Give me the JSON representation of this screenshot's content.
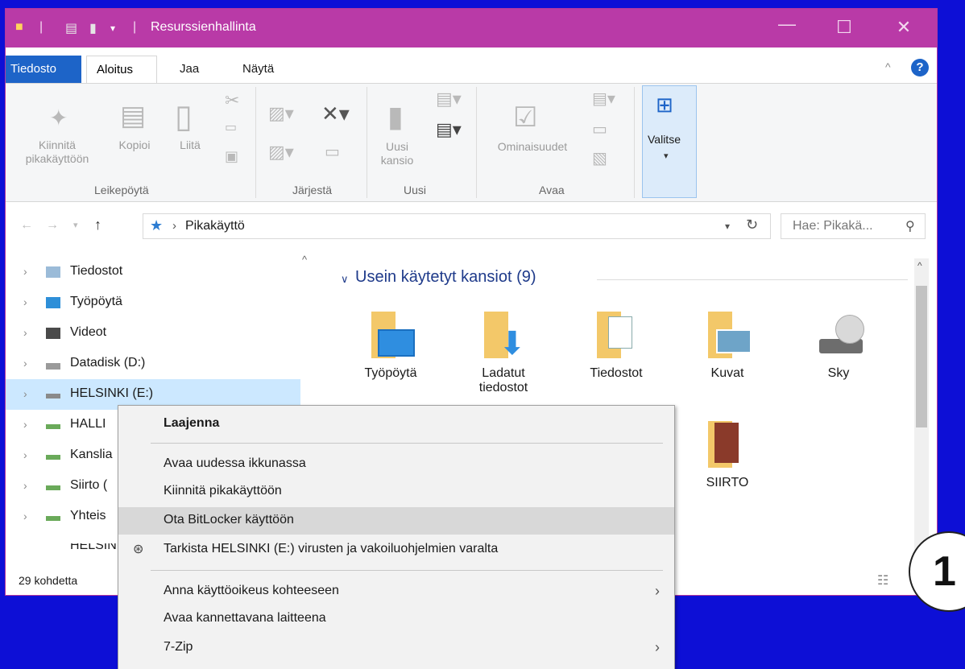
{
  "window": {
    "title": "Resurssienhallinta",
    "minimize": "—",
    "maximize": "☐",
    "close": "✕"
  },
  "ribbon_tabs": {
    "file": "Tiedosto",
    "home": "Aloitus",
    "share": "Jaa",
    "view": "Näytä"
  },
  "ribbon": {
    "pin_label_1": "Kiinnitä",
    "pin_label_2": "pikakäyttöön",
    "copy": "Kopioi",
    "paste": "Liitä",
    "new_folder_1": "Uusi",
    "new_folder_2": "kansio",
    "properties": "Ominaisuudet",
    "select": "Valitse",
    "group_clipboard": "Leikepöytä",
    "group_organize": "Järjestä",
    "group_new": "Uusi",
    "group_open": "Avaa"
  },
  "address": {
    "path": "Pikakäyttö",
    "search_placeholder": "Hae: Pikakä...",
    "separator": "›"
  },
  "nav": {
    "items": [
      {
        "label": "Tiedostot"
      },
      {
        "label": "Työpöytä"
      },
      {
        "label": "Videot"
      },
      {
        "label": "Datadisk (D:)"
      },
      {
        "label": "HELSINKI (E:)"
      },
      {
        "label": "HALLI"
      },
      {
        "label": "Kanslia"
      },
      {
        "label": "Siirto ("
      },
      {
        "label": "Yhteis"
      },
      {
        "label": "HELSINI"
      }
    ]
  },
  "content": {
    "group_title": "Usein käytetyt kansiot (9)",
    "folders": [
      {
        "label": "Työpöytä"
      },
      {
        "label": "Ladatut tiedostot"
      },
      {
        "label": "Tiedostot"
      },
      {
        "label": "Kuvat"
      },
      {
        "label": "Sky"
      },
      {
        "label": "SIIRTO"
      }
    ]
  },
  "status": {
    "count": "29 kohdetta"
  },
  "context_menu": {
    "items": [
      {
        "label": "Laajenna"
      },
      {
        "label": "Avaa uudessa ikkunassa"
      },
      {
        "label": "Kiinnitä pikakäyttöön"
      },
      {
        "label": "Ota BitLocker käyttöön"
      },
      {
        "label": "Tarkista HELSINKI (E:) virusten ja vakoiluohjelmien varalta"
      },
      {
        "label": "Anna käyttöoikeus kohteeseen"
      },
      {
        "label": "Avaa kannettavana laitteena"
      },
      {
        "label": "7-Zip"
      }
    ]
  },
  "badge": {
    "number": "1"
  },
  "colors": {
    "titlebar": "#b93aa7",
    "desktop": "#0d0fd6",
    "accent": "#1d64c8",
    "selection": "#cce8ff"
  }
}
